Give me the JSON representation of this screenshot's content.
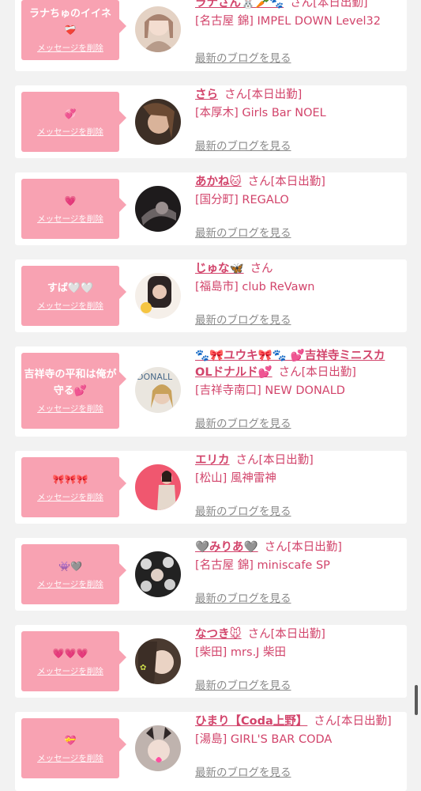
{
  "cards": [
    {
      "message": "ラナちゅのイイネ",
      "emoji": "❤️‍🩹",
      "delete_label": "メッセージを削除",
      "name": "ラナさん🐰🥕🐾",
      "honorific": "さん[本日出勤]",
      "shop": "[名古屋 錦] IMPEL DOWN Level32",
      "blog": "最新のブログを見る",
      "avatar_color": "#c9a79b"
    },
    {
      "message": "",
      "emoji": "💞",
      "delete_label": "メッセージを削除",
      "name": "さら",
      "honorific": "さん[本日出勤]",
      "shop": "[本厚木] Girls Bar NOEL",
      "blog": "最新のブログを見る",
      "avatar_color": "#5a4637"
    },
    {
      "message": "",
      "emoji": "💗",
      "delete_label": "メッセージを削除",
      "name": "あかね🐱",
      "honorific": "さん[本日出勤]",
      "shop": "[国分町] REGALO",
      "blog": "最新のブログを見る",
      "avatar_color": "#2f2b2c"
    },
    {
      "message": "すば🤍🤍",
      "emoji": "",
      "delete_label": "メッセージを削除",
      "name": "じゅな🦋",
      "honorific": "さん",
      "shop": "[福島市] club ReVawn",
      "blog": "最新のブログを見る",
      "avatar_color": "#3b3030"
    },
    {
      "message": "吉祥寺の平和は俺が守る💕",
      "emoji": "",
      "delete_label": "メッセージを削除",
      "name": "🐾🎀ユウキ🎀🐾 💕吉祥寺ミニスカOLドナルド💕",
      "honorific": "さん[本日出勤]",
      "shop": "[吉祥寺南口] NEW DONALD",
      "blog": "最新のブログを見る",
      "avatar_color": "#d8d2c6"
    },
    {
      "message": "",
      "emoji": "🎀🎀🎀",
      "delete_label": "メッセージを削除",
      "name": "エリカ",
      "honorific": "さん[本日出勤]",
      "shop": "[松山] 風神雷神",
      "blog": "最新のブログを見る",
      "avatar_color": "#f0576f"
    },
    {
      "message": "",
      "emoji": "👾🩶",
      "delete_label": "メッセージを削除",
      "name": "🩶みりあ🩶",
      "honorific": "さん[本日出勤]",
      "shop": "[名古屋 錦] miniscafe SP",
      "blog": "最新のブログを見る",
      "avatar_color": "#2b2b2b"
    },
    {
      "message": "",
      "emoji": "💗💗💗",
      "delete_label": "メッセージを削除",
      "name": "なつき🐭",
      "honorific": "さん[本日出勤]",
      "shop": "[柴田] mrs.J 柴田",
      "blog": "最新のブログを見る",
      "avatar_color": "#5e4a3e"
    },
    {
      "message": "",
      "emoji": "💝",
      "delete_label": "メッセージを削除",
      "name": "ひまり【Coda上野】",
      "honorific": "さん[本日出勤]",
      "shop": "[湯島] GIRL'S BAR CODA",
      "blog": "最新のブログを見る",
      "avatar_color": "#8d7b74"
    }
  ]
}
